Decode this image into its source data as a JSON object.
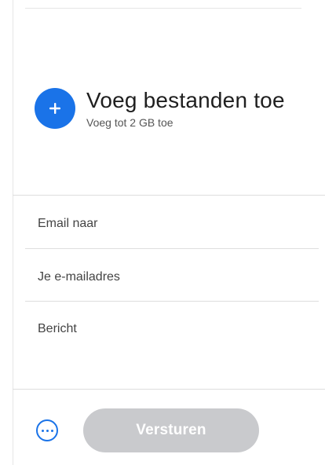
{
  "upload": {
    "title": "Voeg bestanden toe",
    "subtitle": "Voeg tot 2 GB toe",
    "icon": "plus-icon",
    "accent_color": "#1a73e8"
  },
  "form": {
    "email_to_placeholder": "Email naar",
    "your_email_placeholder": "Je e-mailadres",
    "message_placeholder": "Bericht"
  },
  "actions": {
    "more_icon": "more-options-icon",
    "send_label": "Versturen",
    "send_disabled_color": "#c9cacd"
  }
}
